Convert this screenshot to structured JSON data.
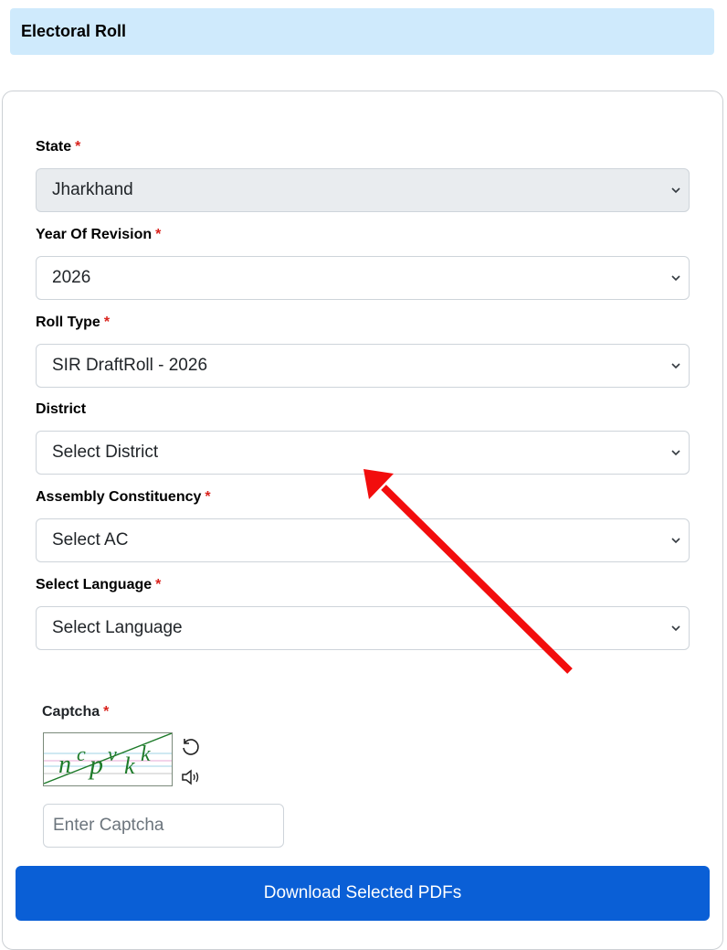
{
  "header": {
    "title": "Electoral Roll"
  },
  "form": {
    "required_mark": "*",
    "state": {
      "label": "State",
      "value": "Jharkhand"
    },
    "year": {
      "label": "Year Of Revision",
      "value": "2026"
    },
    "roll_type": {
      "label": "Roll Type",
      "value": "SIR DraftRoll - 2026"
    },
    "district": {
      "label": "District",
      "value": "Select District"
    },
    "ac": {
      "label": "Assembly Constituency",
      "value": "Select AC"
    },
    "language": {
      "label": "Select Language",
      "value": "Select Language"
    }
  },
  "captcha": {
    "label": "Captcha",
    "image_text": "ncpvkk",
    "input_placeholder": "Enter Captcha",
    "refresh_icon": "refresh-icon",
    "audio_icon": "speaker-icon"
  },
  "actions": {
    "download_label": "Download Selected PDFs"
  },
  "colors": {
    "header_bg": "#cfeafc",
    "required": "#d9231d",
    "primary_button": "#0a5fd6",
    "annotation_arrow": "#f20d0d",
    "captcha_text": "#1e7b2a"
  }
}
